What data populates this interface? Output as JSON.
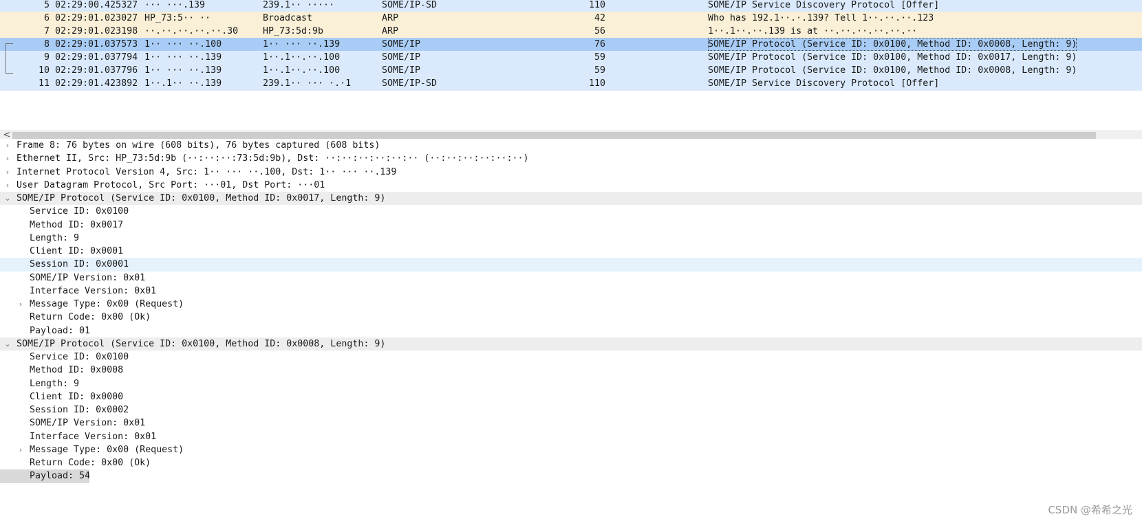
{
  "packet_list": {
    "rows": [
      {
        "no": "5",
        "time": "02:29:00.425327",
        "src": "··· ···.139",
        "dst": "239.1·· ·····",
        "proto": "SOME/IP-SD",
        "len": "110",
        "info": "SOME/IP Service Discovery Protocol [Offer]",
        "bg": "#daeafc"
      },
      {
        "no": "6",
        "time": "02:29:01.023027",
        "src": "HP_73:5·· ··",
        "dst": "Broadcast",
        "proto": "ARP",
        "len": "42",
        "info": "Who has 192.1··.·.139? Tell 1··.··.··.123",
        "bg": "#faf0d7"
      },
      {
        "no": "7",
        "time": "02:29:01.023198",
        "src": "··.··.··.··.··.30",
        "dst": "HP_73:5d:9b",
        "proto": "ARP",
        "len": "56",
        "info": "1··.1··.··.139 is at ··.··.··.··.··.··",
        "bg": "#faf0d7"
      },
      {
        "no": "8",
        "time": "02:29:01.037573",
        "src": "1·· ··· ··.100",
        "dst": "1·· ··· ··.139",
        "proto": "SOME/IP",
        "len": "76",
        "info": "SOME/IP Protocol (Service ID: 0x0100, Method ID: 0x0008, Length: 9)",
        "bg": "#a8ccf5",
        "selected": true
      },
      {
        "no": "9",
        "time": "02:29:01.037794",
        "src": "1·· ··· ··.139",
        "dst": "1··.1··.··.100",
        "proto": "SOME/IP",
        "len": "59",
        "info": "SOME/IP Protocol (Service ID: 0x0100, Method ID: 0x0017, Length: 9)",
        "bg": "#daeafc"
      },
      {
        "no": "10",
        "time": "02:29:01.037796",
        "src": "1·· ··· ··.139",
        "dst": "1··.1··.··.100",
        "proto": "SOME/IP",
        "len": "59",
        "info": "SOME/IP Protocol (Service ID: 0x0100, Method ID: 0x0008, Length: 9)",
        "bg": "#daeafc"
      },
      {
        "no": "11",
        "time": "02:29:01.423892",
        "src": "1··.1·· ··.139",
        "dst": "239.1·· ··· ·.·1",
        "proto": "SOME/IP-SD",
        "len": "110",
        "info": "SOME/IP Service Discovery Protocol [Offer]",
        "bg": "#daeafc"
      }
    ]
  },
  "scrollbar": {
    "left_arrow": "<"
  },
  "detail_tree": {
    "rows": [
      {
        "level": 0,
        "arrow": "›",
        "text": "Frame 8: 76 bytes on wire (608 bits), 76 bytes captured (608 bits)",
        "bg": "#ffffff"
      },
      {
        "level": 0,
        "arrow": "›",
        "text": "Ethernet II, Src: HP_73:5d:9b (··:··:··:73:5d:9b), Dst: ··:··:··:··:··:·· (··:··:··:··:··:··)",
        "bg": "#ffffff"
      },
      {
        "level": 0,
        "arrow": "›",
        "text": "Internet Protocol Version 4, Src: 1·· ··· ··.100, Dst: 1·· ··· ··.139",
        "bg": "#ffffff"
      },
      {
        "level": 0,
        "arrow": "›",
        "text": "User Datagram Protocol, Src Port: ···01, Dst Port: ···01",
        "bg": "#ffffff"
      },
      {
        "level": 0,
        "arrow": "⌄",
        "text": "SOME/IP Protocol (Service ID: 0x0100, Method ID: 0x0017, Length: 9)",
        "bg": "#ededed"
      },
      {
        "level": 1,
        "arrow": "",
        "text": "Service ID: 0x0100",
        "bg": "#ffffff"
      },
      {
        "level": 1,
        "arrow": "",
        "text": "Method ID: 0x0017",
        "bg": "#ffffff"
      },
      {
        "level": 1,
        "arrow": "",
        "text": "Length: 9",
        "bg": "#ffffff"
      },
      {
        "level": 1,
        "arrow": "",
        "text": "Client ID: 0x0001",
        "bg": "#ffffff"
      },
      {
        "level": 1,
        "arrow": "",
        "text": "Session ID: 0x0001",
        "bg": "#e5f1fb"
      },
      {
        "level": 1,
        "arrow": "",
        "text": "SOME/IP Version: 0x01",
        "bg": "#ffffff"
      },
      {
        "level": 1,
        "arrow": "",
        "text": "Interface Version: 0x01",
        "bg": "#ffffff"
      },
      {
        "level": 1,
        "arrow": "›",
        "text": "Message Type: 0x00 (Request)",
        "bg": "#ffffff"
      },
      {
        "level": 1,
        "arrow": "",
        "text": "Return Code: 0x00 (Ok)",
        "bg": "#ffffff"
      },
      {
        "level": 1,
        "arrow": "",
        "text": "Payload: 01",
        "bg": "#ffffff"
      },
      {
        "level": 0,
        "arrow": "⌄",
        "text": "SOME/IP Protocol (Service ID: 0x0100, Method ID: 0x0008, Length: 9)",
        "bg": "#ededed"
      },
      {
        "level": 1,
        "arrow": "",
        "text": "Service ID: 0x0100",
        "bg": "#ffffff"
      },
      {
        "level": 1,
        "arrow": "",
        "text": "Method ID: 0x0008",
        "bg": "#ffffff"
      },
      {
        "level": 1,
        "arrow": "",
        "text": "Length: 9",
        "bg": "#ffffff"
      },
      {
        "level": 1,
        "arrow": "",
        "text": "Client ID: 0x0000",
        "bg": "#ffffff"
      },
      {
        "level": 1,
        "arrow": "",
        "text": "Session ID: 0x0002",
        "bg": "#ffffff"
      },
      {
        "level": 1,
        "arrow": "",
        "text": "SOME/IP Version: 0x01",
        "bg": "#ffffff"
      },
      {
        "level": 1,
        "arrow": "",
        "text": "Interface Version: 0x01",
        "bg": "#ffffff"
      },
      {
        "level": 1,
        "arrow": "›",
        "text": "Message Type: 0x00 (Request)",
        "bg": "#ffffff"
      },
      {
        "level": 1,
        "arrow": "",
        "text": "Return Code: 0x00 (Ok)",
        "bg": "#ffffff"
      },
      {
        "level": 1,
        "arrow": "",
        "text": "Payload: 54",
        "bg": "#d9d9d9",
        "partial": true
      }
    ]
  },
  "watermark": "CSDN @希希之光"
}
